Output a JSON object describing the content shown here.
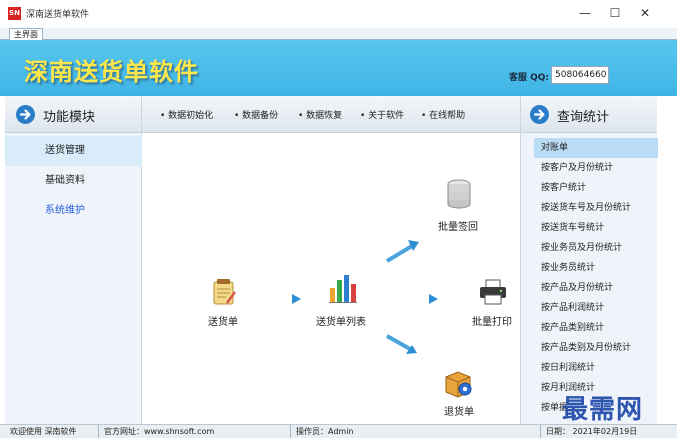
{
  "window": {
    "logo_text": "SN",
    "title": "深南送货单软件",
    "minimize_label": "—",
    "maximize_label": "☐",
    "close_label": "✕"
  },
  "tabs": [
    {
      "label": "主界面"
    }
  ],
  "banner": {
    "title": "深南送货单软件",
    "qq_label": "客服 QQ:",
    "qq_value": "508064660"
  },
  "left_panel": {
    "title": "功能模块",
    "items": [
      {
        "label": "送货管理",
        "active": true
      },
      {
        "label": "基础资料",
        "active": false
      },
      {
        "label": "系统维护",
        "active": false
      }
    ]
  },
  "toolbar": {
    "items": [
      {
        "label": "• 数据初始化"
      },
      {
        "label": "• 数据备份"
      },
      {
        "label": "• 数据恢复"
      },
      {
        "label": "• 关于软件"
      },
      {
        "label": "• 在线帮助"
      }
    ]
  },
  "flow": {
    "delivery_note": "送货单",
    "delivery_list": "送货单列表",
    "batch_sign": "批量签回",
    "batch_print": "批量打印",
    "return_note": "退货单"
  },
  "right_panel": {
    "title": "查询统计",
    "items": [
      {
        "label": "对账单",
        "active": true
      },
      {
        "label": "按客户及月份统计"
      },
      {
        "label": "按客户统计"
      },
      {
        "label": "按送货车号及月份统计"
      },
      {
        "label": "按送货车号统计"
      },
      {
        "label": "按业务员及月份统计"
      },
      {
        "label": "按业务员统计"
      },
      {
        "label": "按产品及月份统计"
      },
      {
        "label": "按产品利润统计"
      },
      {
        "label": "按产品类别统计"
      },
      {
        "label": "按产品类别及月份统计"
      },
      {
        "label": "按日利润统计"
      },
      {
        "label": "按月利润统计"
      },
      {
        "label": "按单据..."
      }
    ]
  },
  "statusbar": {
    "welcome": "欢迎使用 深南软件",
    "website": "官方网址：www.shnsoft.com",
    "operator": "操作员：Admin",
    "date": "日期： 2021年02月19日"
  },
  "watermark": "最需网",
  "colors": {
    "banner": "#45b9e9",
    "banner_title": "#ffe74a",
    "accent_blue": "#2a7cc9",
    "active_item": "#d9ecfa",
    "link_blue": "#2e5fe0"
  }
}
